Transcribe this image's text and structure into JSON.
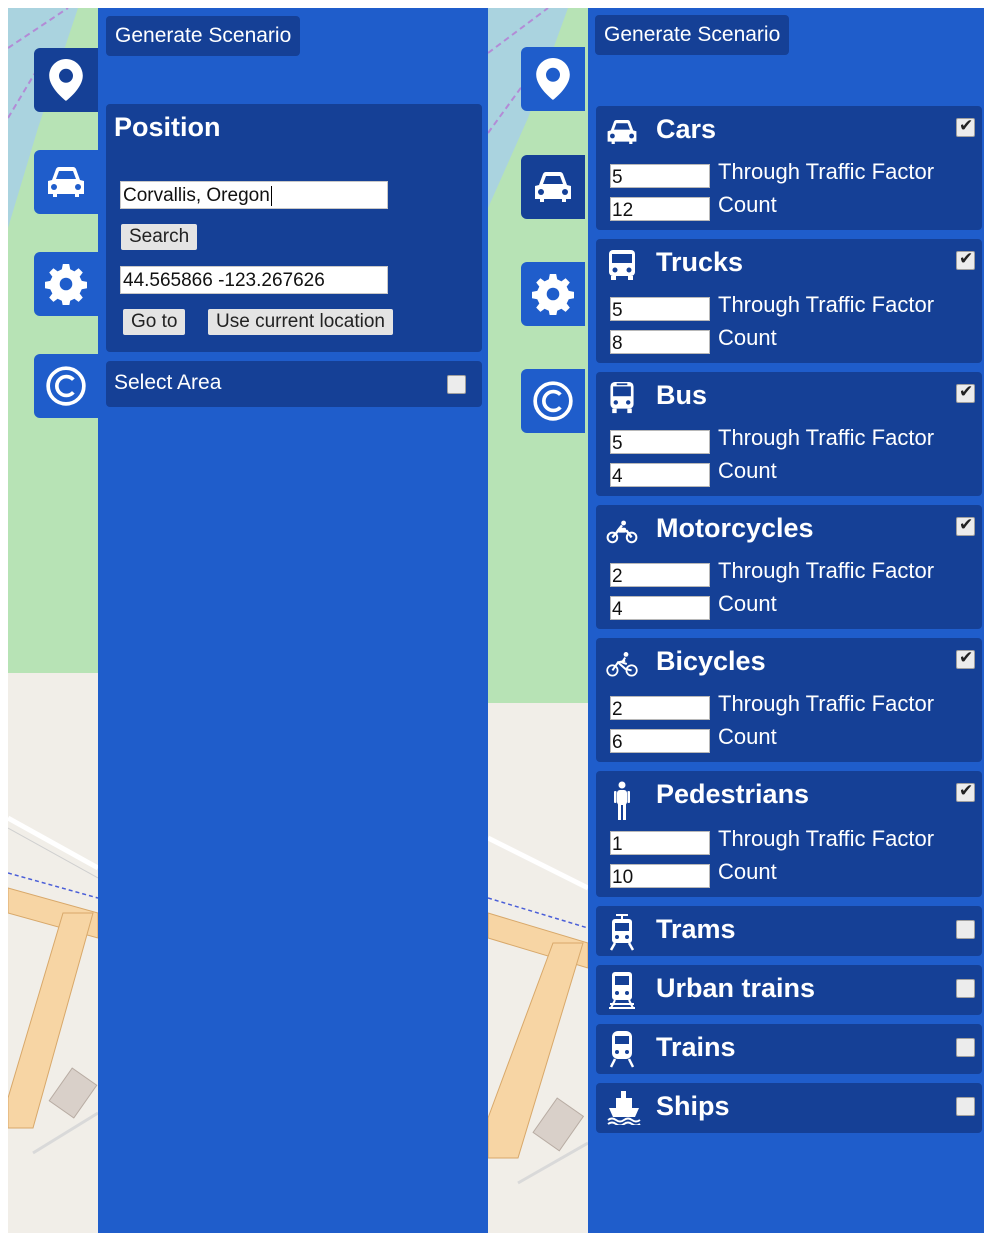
{
  "left": {
    "generate_button": "Generate Scenario",
    "tabs": [
      {
        "name": "position",
        "icon": "map-marker-icon",
        "active": true
      },
      {
        "name": "vehicles",
        "icon": "car-icon",
        "active": false
      },
      {
        "name": "settings",
        "icon": "gear-icon",
        "active": false
      },
      {
        "name": "copyright",
        "icon": "copyright-icon",
        "active": false
      }
    ],
    "position": {
      "title": "Position",
      "search_value": "Corvallis, Oregon",
      "search_button": "Search",
      "coords_value": "44.565866 -123.267626",
      "goto_button": "Go to",
      "current_location_button": "Use current location"
    },
    "select_area": {
      "label": "Select Area",
      "checked": false
    }
  },
  "right": {
    "generate_button": "Generate Scenario",
    "tabs": [
      {
        "name": "position",
        "icon": "map-marker-icon",
        "active": false
      },
      {
        "name": "vehicles",
        "icon": "car-icon",
        "active": true
      },
      {
        "name": "settings",
        "icon": "gear-icon",
        "active": false
      },
      {
        "name": "copyright",
        "icon": "copyright-icon",
        "active": false
      }
    ],
    "factor_label": "Through Traffic Factor",
    "count_label": "Count",
    "vehicles": [
      {
        "label": "Cars",
        "icon": "car-icon",
        "checked": true,
        "factor": "5",
        "count": "12"
      },
      {
        "label": "Trucks",
        "icon": "truck-icon",
        "checked": true,
        "factor": "5",
        "count": "8"
      },
      {
        "label": "Bus",
        "icon": "bus-icon",
        "checked": true,
        "factor": "5",
        "count": "4"
      },
      {
        "label": "Motorcycles",
        "icon": "motorcycle-icon",
        "checked": true,
        "factor": "2",
        "count": "4"
      },
      {
        "label": "Bicycles",
        "icon": "bicycle-icon",
        "checked": true,
        "factor": "2",
        "count": "6"
      },
      {
        "label": "Pedestrians",
        "icon": "pedestrian-icon",
        "checked": true,
        "factor": "1",
        "count": "10"
      }
    ],
    "transit": [
      {
        "label": "Trams",
        "icon": "tram-icon",
        "checked": false
      },
      {
        "label": "Urban trains",
        "icon": "urban-train-icon",
        "checked": false
      },
      {
        "label": "Trains",
        "icon": "train-icon",
        "checked": false
      },
      {
        "label": "Ships",
        "icon": "ship-icon",
        "checked": false
      }
    ]
  },
  "colors": {
    "panel": "#1f5dcb",
    "card": "#154096",
    "map_green": "#b7e3b5",
    "map_background": "#f1eee8",
    "road": "#f7d5a4"
  }
}
